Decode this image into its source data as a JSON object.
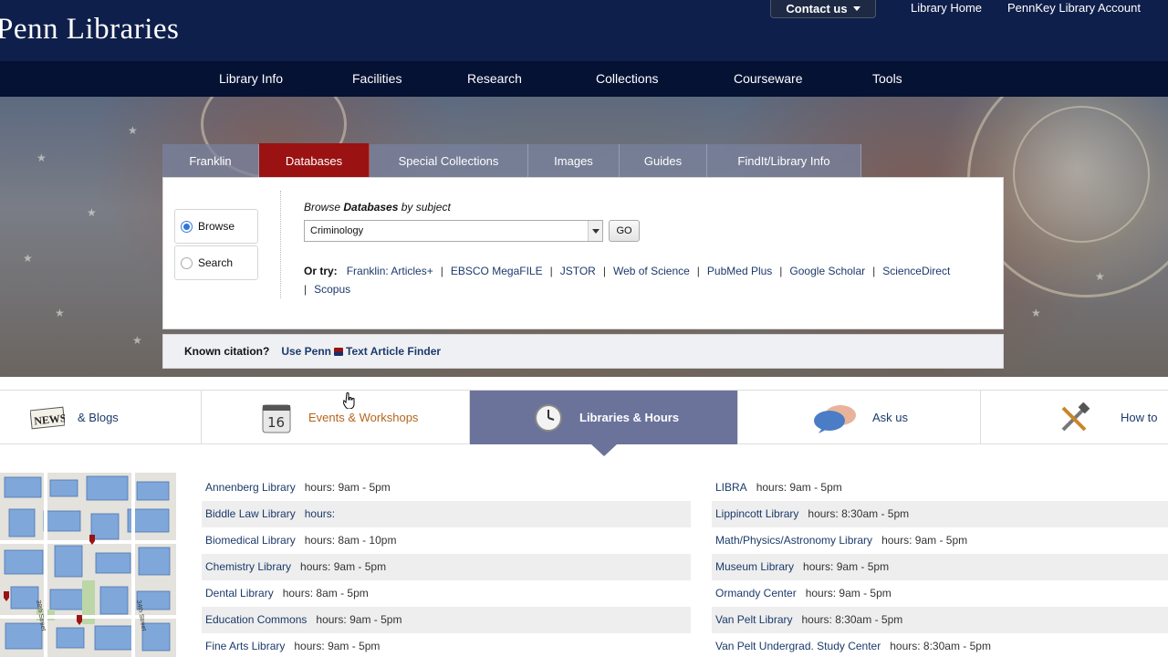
{
  "header": {
    "logo": "Penn Libraries",
    "contact_label": "Contact us",
    "links": [
      "Library Home",
      "PennKey Library Account"
    ]
  },
  "nav": [
    "Library Info",
    "Facilities",
    "Research",
    "Collections",
    "Courseware",
    "Tools"
  ],
  "search_tabs": [
    {
      "label": "Franklin",
      "active": false
    },
    {
      "label": "Databases",
      "active": true
    },
    {
      "label": "Special Collections",
      "active": false
    },
    {
      "label": "Images",
      "active": false
    },
    {
      "label": "Guides",
      "active": false
    },
    {
      "label": "FindIt/Library Info",
      "active": false
    }
  ],
  "panel": {
    "mode_browse": "Browse",
    "mode_search": "Search",
    "selected_mode": "Browse",
    "browse_prefix": "Browse",
    "browse_bold": "Databases",
    "browse_suffix": "by subject",
    "subject_value": "Criminology",
    "go_label": "GO",
    "ortry_label": "Or try:",
    "ortry_links": [
      "Franklin: Articles+",
      "EBSCO MegaFILE",
      "JSTOR",
      "Web of Science",
      "PubMed Plus",
      "Google Scholar",
      "ScienceDirect",
      "Scopus"
    ]
  },
  "citation": {
    "label": "Known citation?",
    "link_prefix": "Use Penn",
    "link_suffix": "Text Article Finder"
  },
  "feature_tabs": [
    {
      "label": "& Blogs",
      "icon": "news-icon",
      "active": false
    },
    {
      "label": "Events & Workshops",
      "icon": "calendar-icon",
      "calendar_day": "16",
      "active": false
    },
    {
      "label": "Libraries & Hours",
      "icon": "clock-icon",
      "active": true
    },
    {
      "label": "Ask us",
      "icon": "speech-bubbles-icon",
      "active": false
    },
    {
      "label": "How to",
      "icon": "tools-icon",
      "active": false
    }
  ],
  "hours_prefix": "hours:",
  "hours_left": [
    {
      "name": "Annenberg Library",
      "hours": "9am - 5pm"
    },
    {
      "name": "Biddle Law Library",
      "hours": ""
    },
    {
      "name": "Biomedical Library",
      "hours": "8am - 10pm"
    },
    {
      "name": "Chemistry Library",
      "hours": "9am - 5pm"
    },
    {
      "name": "Dental Library",
      "hours": "8am - 5pm"
    },
    {
      "name": "Education Commons",
      "hours": "9am - 5pm"
    },
    {
      "name": "Fine Arts Library",
      "hours": "9am - 5pm"
    }
  ],
  "hours_right": [
    {
      "name": "LIBRA",
      "hours": "9am - 5pm"
    },
    {
      "name": "Lippincott Library",
      "hours": "8:30am - 5pm"
    },
    {
      "name": "Math/Physics/Astronomy Library",
      "hours": "9am - 5pm"
    },
    {
      "name": "Museum Library",
      "hours": "9am - 5pm"
    },
    {
      "name": "Ormandy Center",
      "hours": "9am - 5pm"
    },
    {
      "name": "Van Pelt Library",
      "hours": "8:30am - 5pm"
    },
    {
      "name": "Van Pelt Undergrad. Study Center",
      "hours": "8:30am - 5pm"
    }
  ],
  "map": {
    "street_labels": [
      "38th Street",
      "34th Street"
    ]
  },
  "colors": {
    "navy": "#0f1f4b",
    "penn_red": "#9b1212",
    "link": "#1b3a6b",
    "active_tab": "#6b739b"
  }
}
